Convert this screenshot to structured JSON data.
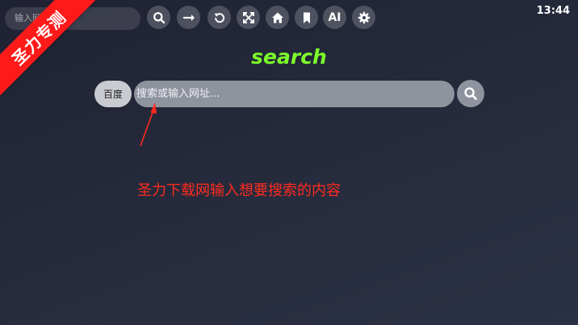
{
  "status": {
    "time": "13:44"
  },
  "watermark": {
    "text": "圣力专测"
  },
  "topbar": {
    "mini_search_placeholder": "输入网址..."
  },
  "toolbar": {
    "items": [
      {
        "icon": "search-icon"
      },
      {
        "icon": "arrow-right-icon"
      },
      {
        "icon": "reload-icon"
      },
      {
        "icon": "fullscreen-icon"
      },
      {
        "icon": "home-icon"
      },
      {
        "icon": "bookmark-icon"
      },
      {
        "icon": "ai-icon",
        "label": "AI"
      },
      {
        "icon": "settings-icon"
      }
    ]
  },
  "main": {
    "brand": "search",
    "engine_label": "百度",
    "search_placeholder": "搜索或输入网址...",
    "search_value": ""
  },
  "annotation": {
    "text": "圣力下载网输入想要搜索的内容"
  },
  "colors": {
    "brand": "#7CFC2A",
    "annotation": "#ff2a1f",
    "ribbon": "#ff1a1a",
    "field": "#8f939e",
    "engine_button": "#c9cbd1"
  }
}
